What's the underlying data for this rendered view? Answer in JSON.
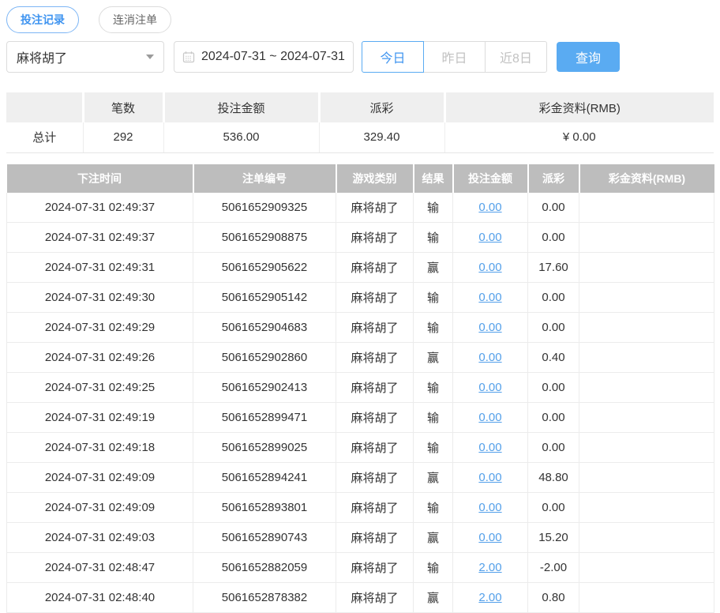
{
  "tabs": [
    {
      "label": "投注记录",
      "active": true
    },
    {
      "label": "连消注单",
      "active": false
    }
  ],
  "filters": {
    "game_select": {
      "value": "麻将胡了"
    },
    "date_range": "2024-07-31 ~ 2024-07-31",
    "quick_buttons": [
      {
        "label": "今日",
        "active": true
      },
      {
        "label": "昨日",
        "active": false
      },
      {
        "label": "近8日",
        "active": false
      }
    ],
    "search_label": "查询"
  },
  "summary": {
    "headers": [
      "",
      "笔数",
      "投注金额",
      "派彩",
      "彩金资料(RMB)"
    ],
    "row": {
      "label": "总计",
      "count": "292",
      "bet_amount": "536.00",
      "payout": "329.40",
      "bonus": "¥ 0.00"
    }
  },
  "table": {
    "headers": [
      "下注时间",
      "注单编号",
      "游戏类别",
      "结果",
      "投注金额",
      "派彩",
      "彩金资料(RMB)"
    ],
    "rows": [
      {
        "time": "2024-07-31 02:49:37",
        "bet_id": "5061652909325",
        "game": "麻将胡了",
        "result": "输",
        "bet_amount": "0.00",
        "payout": "0.00",
        "bonus": ""
      },
      {
        "time": "2024-07-31 02:49:37",
        "bet_id": "5061652908875",
        "game": "麻将胡了",
        "result": "输",
        "bet_amount": "0.00",
        "payout": "0.00",
        "bonus": ""
      },
      {
        "time": "2024-07-31 02:49:31",
        "bet_id": "5061652905622",
        "game": "麻将胡了",
        "result": "赢",
        "bet_amount": "0.00",
        "payout": "17.60",
        "bonus": ""
      },
      {
        "time": "2024-07-31 02:49:30",
        "bet_id": "5061652905142",
        "game": "麻将胡了",
        "result": "输",
        "bet_amount": "0.00",
        "payout": "0.00",
        "bonus": ""
      },
      {
        "time": "2024-07-31 02:49:29",
        "bet_id": "5061652904683",
        "game": "麻将胡了",
        "result": "输",
        "bet_amount": "0.00",
        "payout": "0.00",
        "bonus": ""
      },
      {
        "time": "2024-07-31 02:49:26",
        "bet_id": "5061652902860",
        "game": "麻将胡了",
        "result": "赢",
        "bet_amount": "0.00",
        "payout": "0.40",
        "bonus": ""
      },
      {
        "time": "2024-07-31 02:49:25",
        "bet_id": "5061652902413",
        "game": "麻将胡了",
        "result": "输",
        "bet_amount": "0.00",
        "payout": "0.00",
        "bonus": ""
      },
      {
        "time": "2024-07-31 02:49:19",
        "bet_id": "5061652899471",
        "game": "麻将胡了",
        "result": "输",
        "bet_amount": "0.00",
        "payout": "0.00",
        "bonus": ""
      },
      {
        "time": "2024-07-31 02:49:18",
        "bet_id": "5061652899025",
        "game": "麻将胡了",
        "result": "输",
        "bet_amount": "0.00",
        "payout": "0.00",
        "bonus": ""
      },
      {
        "time": "2024-07-31 02:49:09",
        "bet_id": "5061652894241",
        "game": "麻将胡了",
        "result": "赢",
        "bet_amount": "0.00",
        "payout": "48.80",
        "bonus": ""
      },
      {
        "time": "2024-07-31 02:49:09",
        "bet_id": "5061652893801",
        "game": "麻将胡了",
        "result": "输",
        "bet_amount": "0.00",
        "payout": "0.00",
        "bonus": ""
      },
      {
        "time": "2024-07-31 02:49:03",
        "bet_id": "5061652890743",
        "game": "麻将胡了",
        "result": "赢",
        "bet_amount": "0.00",
        "payout": "15.20",
        "bonus": ""
      },
      {
        "time": "2024-07-31 02:48:47",
        "bet_id": "5061652882059",
        "game": "麻将胡了",
        "result": "输",
        "bet_amount": "2.00",
        "payout": "-2.00",
        "bonus": ""
      },
      {
        "time": "2024-07-31 02:48:40",
        "bet_id": "5061652878382",
        "game": "麻将胡了",
        "result": "赢",
        "bet_amount": "2.00",
        "payout": "0.80",
        "bonus": ""
      }
    ]
  },
  "colors": {
    "accent": "#3f94f0",
    "accent-border": "#7db6f5",
    "button-bg": "#5aabf2",
    "link": "#54a0ea",
    "negative": "#ee4e45",
    "table-header-bg": "#bdbdbd",
    "summary-header-bg": "#efefef",
    "border": "#dcdcdc",
    "row-border": "#ececec",
    "muted": "#c2c2c2",
    "text": "#333333"
  }
}
